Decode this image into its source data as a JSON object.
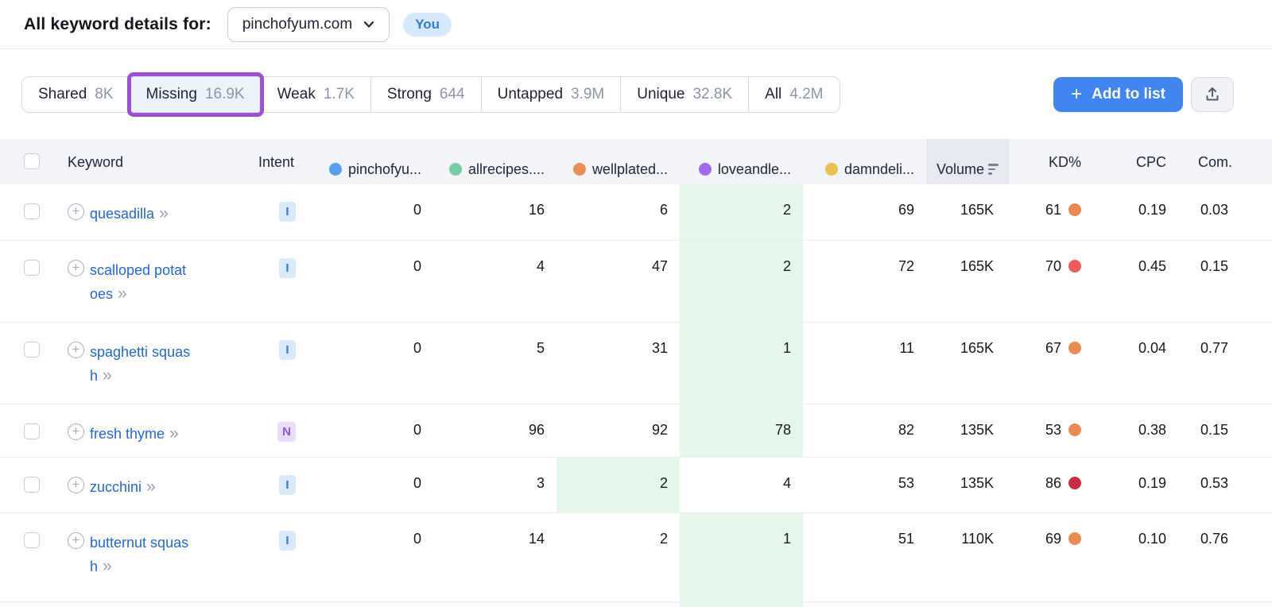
{
  "header": {
    "title": "All keyword details for:",
    "domain_selector": {
      "value": "pinchofyum.com"
    },
    "you_badge": "You"
  },
  "tabs": [
    {
      "label": "Shared",
      "count": "8K"
    },
    {
      "label": "Missing",
      "count": "16.9K",
      "annotated": true
    },
    {
      "label": "Weak",
      "count": "1.7K"
    },
    {
      "label": "Strong",
      "count": "644"
    },
    {
      "label": "Untapped",
      "count": "3.9M"
    },
    {
      "label": "Unique",
      "count": "32.8K"
    },
    {
      "label": "All",
      "count": "4.2M"
    }
  ],
  "toolbar": {
    "add_to_list": {
      "plus": "+",
      "label": "Add to list"
    },
    "export_icon": "upload-arrow"
  },
  "table": {
    "columns": {
      "keyword": "Keyword",
      "intent": "Intent",
      "competitors": [
        {
          "label": "pinchofyu...",
          "color": "blue"
        },
        {
          "label": "allrecipes....",
          "color": "green"
        },
        {
          "label": "wellplated...",
          "color": "orange"
        },
        {
          "label": "loveandle...",
          "color": "purple"
        },
        {
          "label": "damndeli...",
          "color": "yellow"
        }
      ],
      "volume": "Volume",
      "volume_sorted": true,
      "kd": "KD%",
      "cpc": "CPC",
      "com": "Com."
    },
    "rows": [
      {
        "keyword": "quesadilla",
        "arrows": "»",
        "intent": "I",
        "pinchofyum": "0",
        "allrecipes": "16",
        "wellplated": "6",
        "loveandlemons": "2",
        "damndelicious": "69",
        "highlight": "loveandlemons",
        "volume": "165K",
        "kd": "61",
        "kd_dot": "orange",
        "cpc": "0.19",
        "com": "0.03"
      },
      {
        "keyword": "scalloped potatoes",
        "arrows": "»",
        "intent": "I",
        "pinchofyum": "0",
        "allrecipes": "4",
        "wellplated": "47",
        "loveandlemons": "2",
        "damndelicious": "72",
        "highlight": "loveandlemons",
        "volume": "165K",
        "kd": "70",
        "kd_dot": "red",
        "cpc": "0.45",
        "com": "0.15"
      },
      {
        "keyword": "spaghetti squash",
        "arrows": "»",
        "intent": "I",
        "pinchofyum": "0",
        "allrecipes": "5",
        "wellplated": "31",
        "loveandlemons": "1",
        "damndelicious": "11",
        "highlight": "loveandlemons",
        "volume": "165K",
        "kd": "67",
        "kd_dot": "orange",
        "cpc": "0.04",
        "com": "0.77"
      },
      {
        "keyword": "fresh thyme",
        "arrows": "»",
        "intent": "N",
        "pinchofyum": "0",
        "allrecipes": "96",
        "wellplated": "92",
        "loveandlemons": "78",
        "damndelicious": "82",
        "highlight": "loveandlemons",
        "volume": "135K",
        "kd": "53",
        "kd_dot": "orange",
        "cpc": "0.38",
        "com": "0.15"
      },
      {
        "keyword": "zucchini",
        "arrows": "»",
        "intent": "I",
        "pinchofyum": "0",
        "allrecipes": "3",
        "wellplated": "2",
        "loveandlemons": "4",
        "damndelicious": "53",
        "highlight": "wellplated",
        "volume": "135K",
        "kd": "86",
        "kd_dot": "crimson",
        "cpc": "0.19",
        "com": "0.53"
      },
      {
        "keyword": "butternut squash",
        "arrows": "»",
        "intent": "I",
        "pinchofyum": "0",
        "allrecipes": "14",
        "wellplated": "2",
        "loveandlemons": "1",
        "damndelicious": "51",
        "highlight": "loveandlemons",
        "volume": "110K",
        "kd": "69",
        "kd_dot": "orange",
        "cpc": "0.10",
        "com": "0.76"
      }
    ]
  },
  "colors": {
    "annotation_purple": "#9d4edb",
    "highlight_green": "#e4f7ea",
    "link_blue": "#2566d8",
    "button_blue": "#4186f0",
    "dot_blue": "#54a0f0",
    "dot_green": "#72cfa0",
    "dot_orange": "#ec8e56",
    "dot_purple": "#a468f0",
    "dot_yellow": "#ecc04c",
    "kd_orange": "#ec8a50",
    "kd_red": "#ef5b5b",
    "kd_crimson": "#c92b44"
  }
}
